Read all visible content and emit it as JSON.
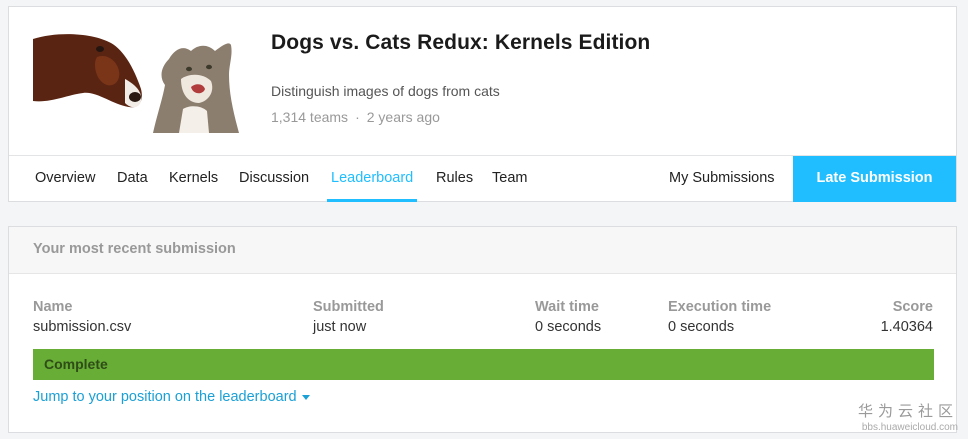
{
  "competition": {
    "title": "Dogs vs. Cats Redux: Kernels Edition",
    "description": "Distinguish images of dogs from cats",
    "teams": "1,314 teams",
    "separator": "·",
    "age": "2 years ago"
  },
  "nav": {
    "tabs": [
      "Overview",
      "Data",
      "Kernels",
      "Discussion",
      "Leaderboard",
      "Rules",
      "Team"
    ],
    "active_tab": "Leaderboard",
    "my_submissions": "My Submissions",
    "late_submission": "Late Submission"
  },
  "submission": {
    "header": "Your most recent submission",
    "columns": {
      "name": {
        "label": "Name",
        "value": "submission.csv"
      },
      "submitted": {
        "label": "Submitted",
        "value": "just now"
      },
      "wait_time": {
        "label": "Wait time",
        "value": "0 seconds"
      },
      "execution_time": {
        "label": "Execution time",
        "value": "0 seconds"
      },
      "score": {
        "label": "Score",
        "value": "1.40364"
      }
    },
    "status": "Complete",
    "jump_link": "Jump to your position on the leaderboard"
  },
  "watermark": {
    "chinese": "华为云社区",
    "url": "bbs.huaweicloud.com"
  },
  "colors": {
    "accent": "#20beff",
    "status_complete": "#67ad36",
    "link": "#1ba0d6"
  }
}
